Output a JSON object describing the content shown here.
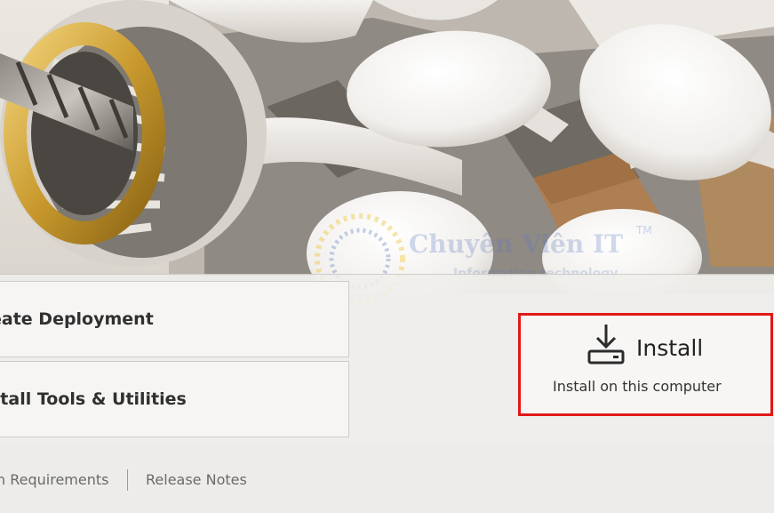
{
  "deploy_button": {
    "label": "eate Deployment"
  },
  "tools_button": {
    "label": "stall Tools & Utilities"
  },
  "install": {
    "title": "Install",
    "subtitle": "Install on this computer"
  },
  "footer": {
    "requirements": "n Requirements",
    "release_notes": "Release Notes"
  },
  "watermark": {
    "brand": "Chuyên Viên IT",
    "tagline": "Information technology",
    "tm": "TM"
  },
  "colors": {
    "highlight": "#e21818",
    "background": "#eceae6"
  },
  "icons": {
    "install": "download-tray-icon"
  }
}
